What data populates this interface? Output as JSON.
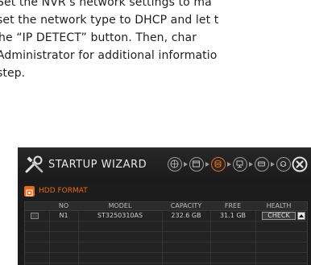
{
  "instructions": {
    "lines": [
      "Set the NVR’s network settings to ma",
      "set the network type to DHCP and let t",
      "he “IP DETECT” button. Then, char",
      "Administrator for additional informatio",
      "step."
    ]
  },
  "wizard": {
    "title": "STARTUP WIZARD",
    "section_label": "HDD FORMAT",
    "accent_color": "#e8691b",
    "steps": [
      {
        "icon": "globe-icon",
        "active": false
      },
      {
        "icon": "calendar-icon",
        "active": false
      },
      {
        "icon": "hdd-icon",
        "active": true
      },
      {
        "icon": "network-icon",
        "active": false
      },
      {
        "icon": "recorder-icon",
        "active": false
      },
      {
        "icon": "camera-icon",
        "active": false
      }
    ],
    "table": {
      "headers": [
        "NO",
        "MODEL",
        "CAPACITY",
        "FREE",
        "HEALTH"
      ],
      "rows": [
        {
          "no": "N1",
          "model": "ST3250310AS",
          "capacity": "232.6 GB",
          "free": "31.1 GB",
          "health": "CHECK"
        }
      ]
    }
  }
}
